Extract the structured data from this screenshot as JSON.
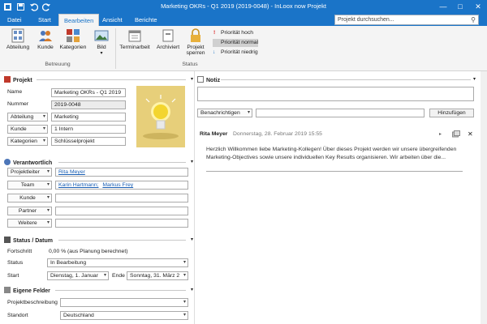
{
  "window": {
    "title": "Marketing OKRs - Q1 2019 (2019-0048) - InLoox now Projekt"
  },
  "tabs": [
    "Datei",
    "Start",
    "Bearbeiten",
    "Ansicht",
    "Berichte"
  ],
  "search": {
    "placeholder": "Projekt durchsuchen..."
  },
  "ribbon": {
    "betreuung": {
      "buttons": [
        "Abteilung",
        "Kunde",
        "Kategorien",
        "Bild"
      ],
      "label": "Betreuung"
    },
    "status": {
      "buttons": [
        "Terminarbeit",
        "Archiviert",
        "Projekt sperren"
      ],
      "label": "Status"
    },
    "priority": {
      "high": "Priorität hoch",
      "normal": "Priorität normal",
      "low": "Priorität niedrig"
    }
  },
  "projekt": {
    "header": "Projekt",
    "name_label": "Name",
    "name_value": "Marketing OKRs - Q1 2019",
    "number_label": "Nummer",
    "number_value": "2019-0048",
    "abteilung_label": "Abteilung",
    "abteilung_value": "Marketing",
    "kunde_label": "Kunde",
    "kunde_value": "1 Intern",
    "kategorien_label": "Kategorien",
    "kategorien_value": "Schlüsselprojekt"
  },
  "verantwortlich": {
    "header": "Verantwortlich",
    "projektleiter_label": "Projektleiter",
    "projektleiter_value": "Rita Meyer",
    "team_label": "Team",
    "team_value_1": "Karin Hartmann;",
    "team_value_2": "Markus Frey",
    "kunde_label": "Kunde",
    "partner_label": "Partner",
    "weitere_label": "Weitere"
  },
  "status_datum": {
    "header": "Status / Datum",
    "fortschritt_label": "Fortschritt",
    "fortschritt_value": "0,00 % (aus Planung berechnet)",
    "status_label": "Status",
    "status_value": "In Bearbeitung",
    "start_label": "Start",
    "start_value": "Dienstag, 1. Januar",
    "ende_label": "Ende",
    "ende_value": "Sonntag, 31. März 2"
  },
  "eigene_felder": {
    "header": "Eigene Felder",
    "beschreibung_label": "Projektbeschreibung",
    "standort_label": "Standort",
    "standort_value": "Deutschland"
  },
  "notiz": {
    "header": "Notiz",
    "benachrichtigen": "Benachrichtigen",
    "hinzufuegen": "Hinzufügen",
    "author": "Rita Meyer",
    "date": "Donnerstag, 28. Februar 2019 15:55",
    "text": "Herzlich Willkommen liebe Marketing-Kollegen! Über dieses Projekt werden wir unsere übergreifenden Marketing-Objectives sowie unsere individuellen Key Results organisieren. Wir arbeiten über die..."
  },
  "colors": {
    "accent": "#1a74c8",
    "link": "#1a5fb4",
    "image_bg": "#e7cf7a"
  },
  "icons": [
    "save-icon",
    "undo-icon",
    "redo-icon",
    "minimize-icon",
    "maximize-icon",
    "close-icon",
    "search-icon"
  ]
}
